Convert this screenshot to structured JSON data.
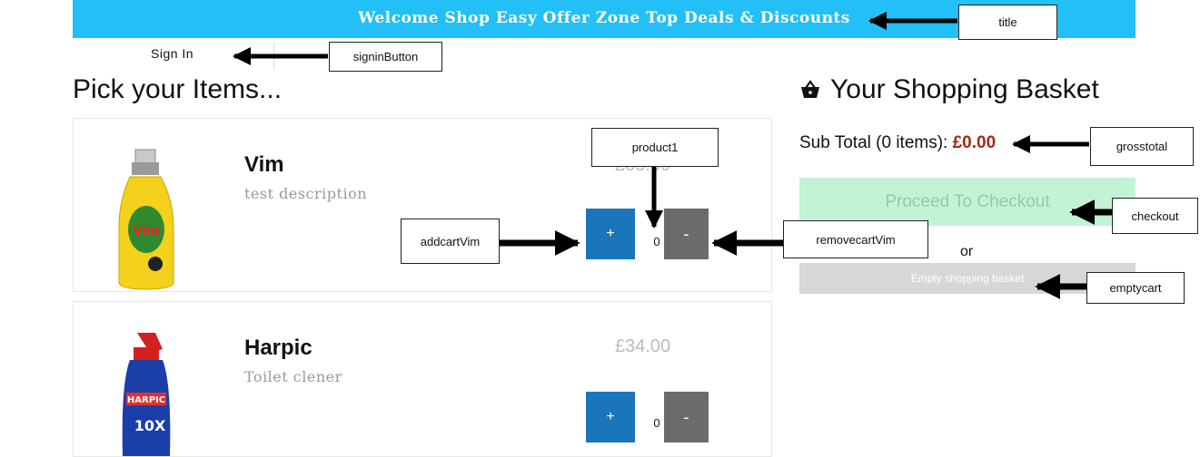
{
  "header": {
    "title": "Welcome Shop Easy Offer Zone Top Deals & Discounts"
  },
  "signin": {
    "label": "Sign In"
  },
  "products_section": {
    "heading": "Pick your Items..."
  },
  "products": [
    {
      "name": "Vim",
      "description": "test description",
      "price": "£85.00",
      "quantity": "0",
      "add_label": "+",
      "remove_label": "-"
    },
    {
      "name": "Harpic",
      "description": "Toilet clener",
      "price": "£34.00",
      "quantity": "0",
      "add_label": "+",
      "remove_label": "-"
    }
  ],
  "basket": {
    "heading": "Your Shopping Basket",
    "subtotal_label": "Sub Total (0 items):",
    "subtotal_amount": "£0.00",
    "checkout_label": "Proceed To Checkout",
    "or_text": "or",
    "empty_label": "Empty shopping basket"
  },
  "annotations": {
    "title": "title",
    "signin": "signinButton",
    "product1": "product1",
    "addcart": "addcartVim",
    "removecart": "removecartVim",
    "grosstotal": "grosstotal",
    "checkout": "checkout",
    "emptycart": "emptycart"
  },
  "colors": {
    "banner": "#22c0f7",
    "add_button": "#1b75bb",
    "remove_button": "#6b6b6b",
    "checkout_bg": "#c2f3d4",
    "subtotal_amount": "#a32a16",
    "empty_bg": "#d7d7d7"
  }
}
